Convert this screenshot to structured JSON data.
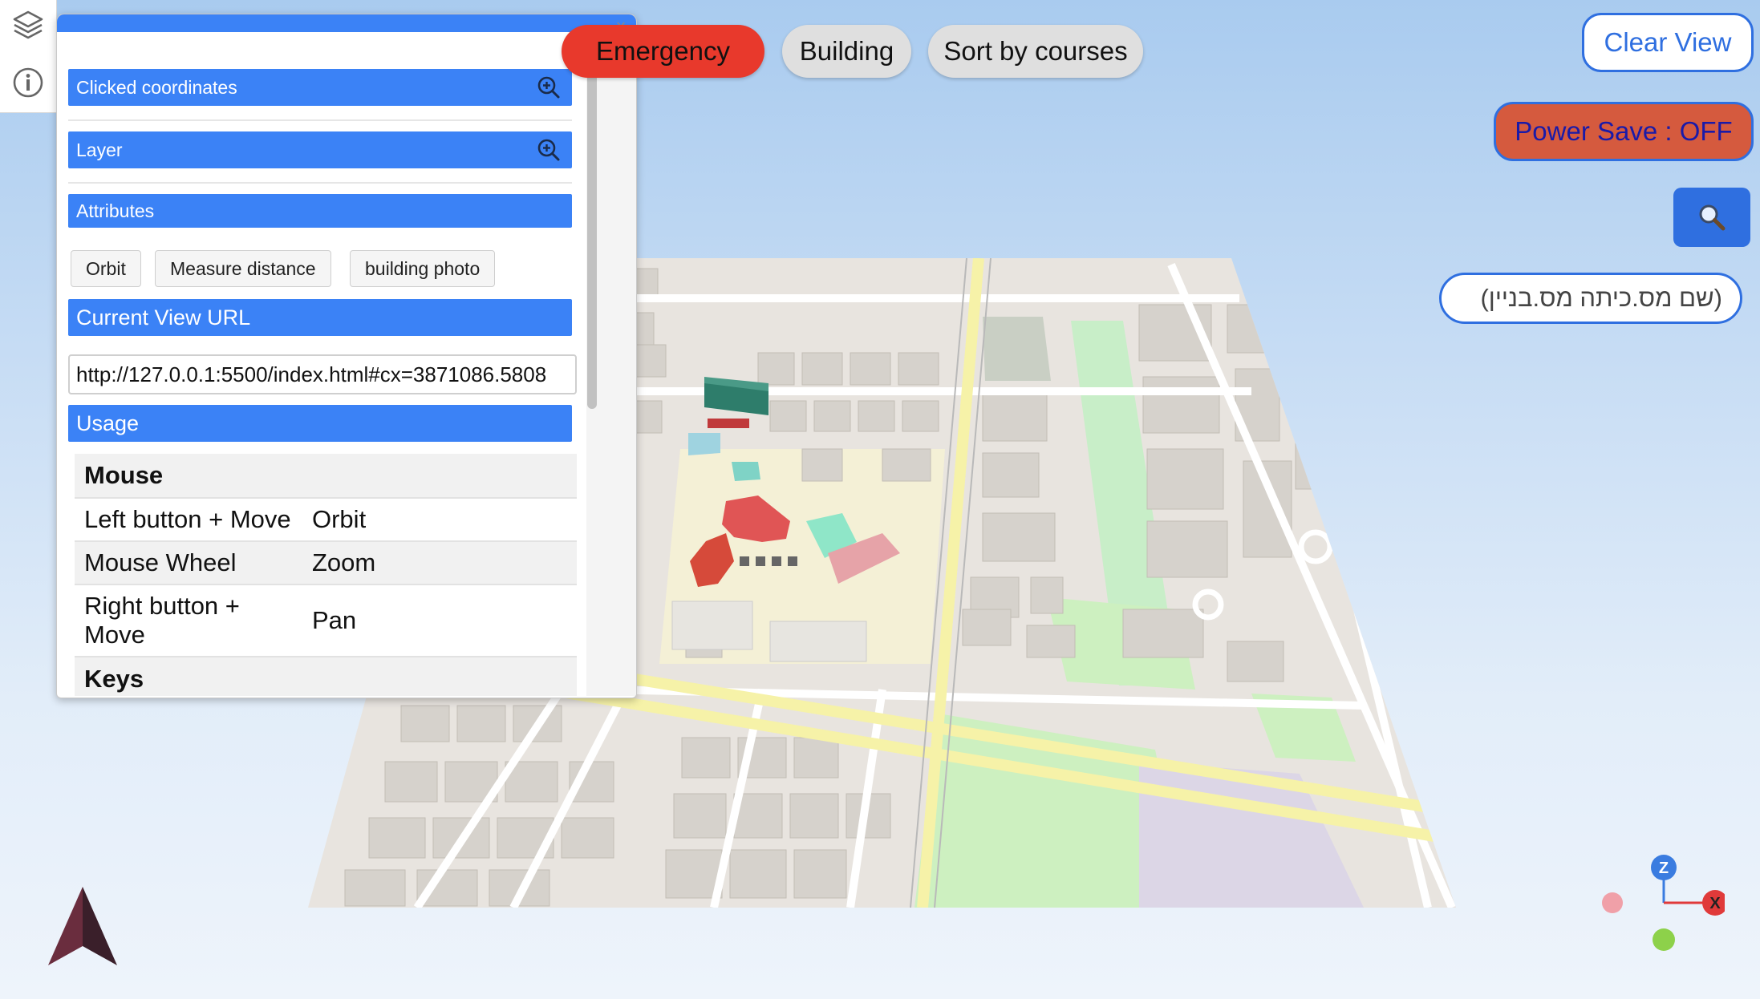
{
  "toolbar": {
    "layers_icon": "layers-icon",
    "info_icon": "info-icon"
  },
  "panel": {
    "close_glyph": "×",
    "sections": {
      "clicked_coordinates": "Clicked coordinates",
      "layer": "Layer",
      "attributes": "Attributes",
      "current_view_url": "Current View URL",
      "usage": "Usage"
    },
    "tools": {
      "orbit": "Orbit",
      "measure_distance": "Measure distance",
      "building_photo": "building photo"
    },
    "url_value": "http://127.0.0.1:5500/index.html#cx=3871086.5808",
    "usage": {
      "mouse_header": "Mouse",
      "rows": [
        {
          "input": "Left button + Move",
          "action": "Orbit"
        },
        {
          "input": "Mouse Wheel",
          "action": "Zoom"
        },
        {
          "input": "Right button + Move",
          "action": "Pan"
        }
      ],
      "keys_header": "Keys"
    }
  },
  "top_buttons": {
    "emergency": "Emergency",
    "building": "Building",
    "sort_by_courses": "Sort by courses"
  },
  "right_controls": {
    "clear_view": "Clear View",
    "power_save": "Power Save : OFF",
    "search_placeholder": "(שם מס.כיתה מס.בניין)"
  },
  "axes": {
    "z_label": "Z",
    "x_label": "X"
  },
  "colors": {
    "accent_blue": "#3b82f6",
    "emergency_red": "#e8392c",
    "power_save_bg": "#d55a3e"
  }
}
